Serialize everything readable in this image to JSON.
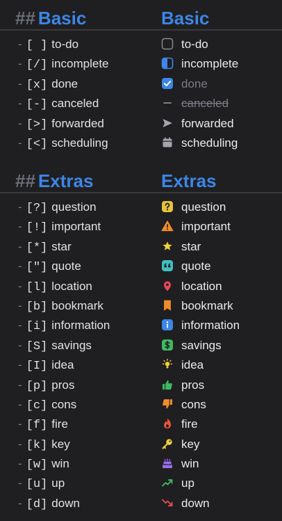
{
  "basic": {
    "hashes": "##",
    "title_left": "Basic",
    "title_right": "Basic",
    "items": [
      {
        "dash": "-",
        "marker": "[ ]",
        "label": "to-do",
        "rendered": "to-do",
        "icon": "empty-checkbox-icon"
      },
      {
        "dash": "-",
        "marker": "[/]",
        "label": "incomplete",
        "rendered": "incomplete",
        "icon": "half-checkbox-icon"
      },
      {
        "dash": "-",
        "marker": "[x]",
        "label": "done",
        "rendered": "done",
        "icon": "checked-checkbox-icon"
      },
      {
        "dash": "-",
        "marker": "[-]",
        "label": "canceled",
        "rendered": "canceled",
        "icon": "dash-icon"
      },
      {
        "dash": "-",
        "marker": "[>]",
        "label": "forwarded",
        "rendered": "forwarded",
        "icon": "send-arrow-icon"
      },
      {
        "dash": "-",
        "marker": "[<]",
        "label": "scheduling",
        "rendered": "scheduling",
        "icon": "calendar-icon"
      }
    ]
  },
  "extras": {
    "hashes": "##",
    "title_left": "Extras",
    "title_right": "Extras",
    "items": [
      {
        "dash": "-",
        "marker": "[?]",
        "label": "question",
        "rendered": "question",
        "icon": "question-icon"
      },
      {
        "dash": "-",
        "marker": "[!]",
        "label": "important",
        "rendered": "important",
        "icon": "warning-icon"
      },
      {
        "dash": "-",
        "marker": "[*]",
        "label": "star",
        "rendered": "star",
        "icon": "star-icon"
      },
      {
        "dash": "-",
        "marker": "[\"]",
        "label": "quote",
        "rendered": "quote",
        "icon": "quote-icon"
      },
      {
        "dash": "-",
        "marker": "[l]",
        "label": "location",
        "rendered": "location",
        "icon": "location-pin-icon"
      },
      {
        "dash": "-",
        "marker": "[b]",
        "label": "bookmark",
        "rendered": "bookmark",
        "icon": "bookmark-icon"
      },
      {
        "dash": "-",
        "marker": "[i]",
        "label": "information",
        "rendered": "information",
        "icon": "info-icon"
      },
      {
        "dash": "-",
        "marker": "[S]",
        "label": "savings",
        "rendered": "savings",
        "icon": "dollar-icon"
      },
      {
        "dash": "-",
        "marker": "[I]",
        "label": "idea",
        "rendered": "idea",
        "icon": "lightbulb-icon"
      },
      {
        "dash": "-",
        "marker": "[p]",
        "label": "pros",
        "rendered": "pros",
        "icon": "thumbs-up-icon"
      },
      {
        "dash": "-",
        "marker": "[c]",
        "label": "cons",
        "rendered": "cons",
        "icon": "thumbs-down-icon"
      },
      {
        "dash": "-",
        "marker": "[f]",
        "label": "fire",
        "rendered": "fire",
        "icon": "fire-icon"
      },
      {
        "dash": "-",
        "marker": "[k]",
        "label": "key",
        "rendered": "key",
        "icon": "key-icon"
      },
      {
        "dash": "-",
        "marker": "[w]",
        "label": "win",
        "rendered": "win",
        "icon": "cake-icon"
      },
      {
        "dash": "-",
        "marker": "[u]",
        "label": "up",
        "rendered": "up",
        "icon": "trend-up-icon"
      },
      {
        "dash": "-",
        "marker": "[d]",
        "label": "down",
        "rendered": "down",
        "icon": "trend-down-icon"
      }
    ]
  },
  "colors": {
    "background": "#1f1f21",
    "heading": "#3d86e8",
    "hashes": "#6c6f78",
    "text": "#e6e6e6",
    "muted": "#7a7c84"
  }
}
